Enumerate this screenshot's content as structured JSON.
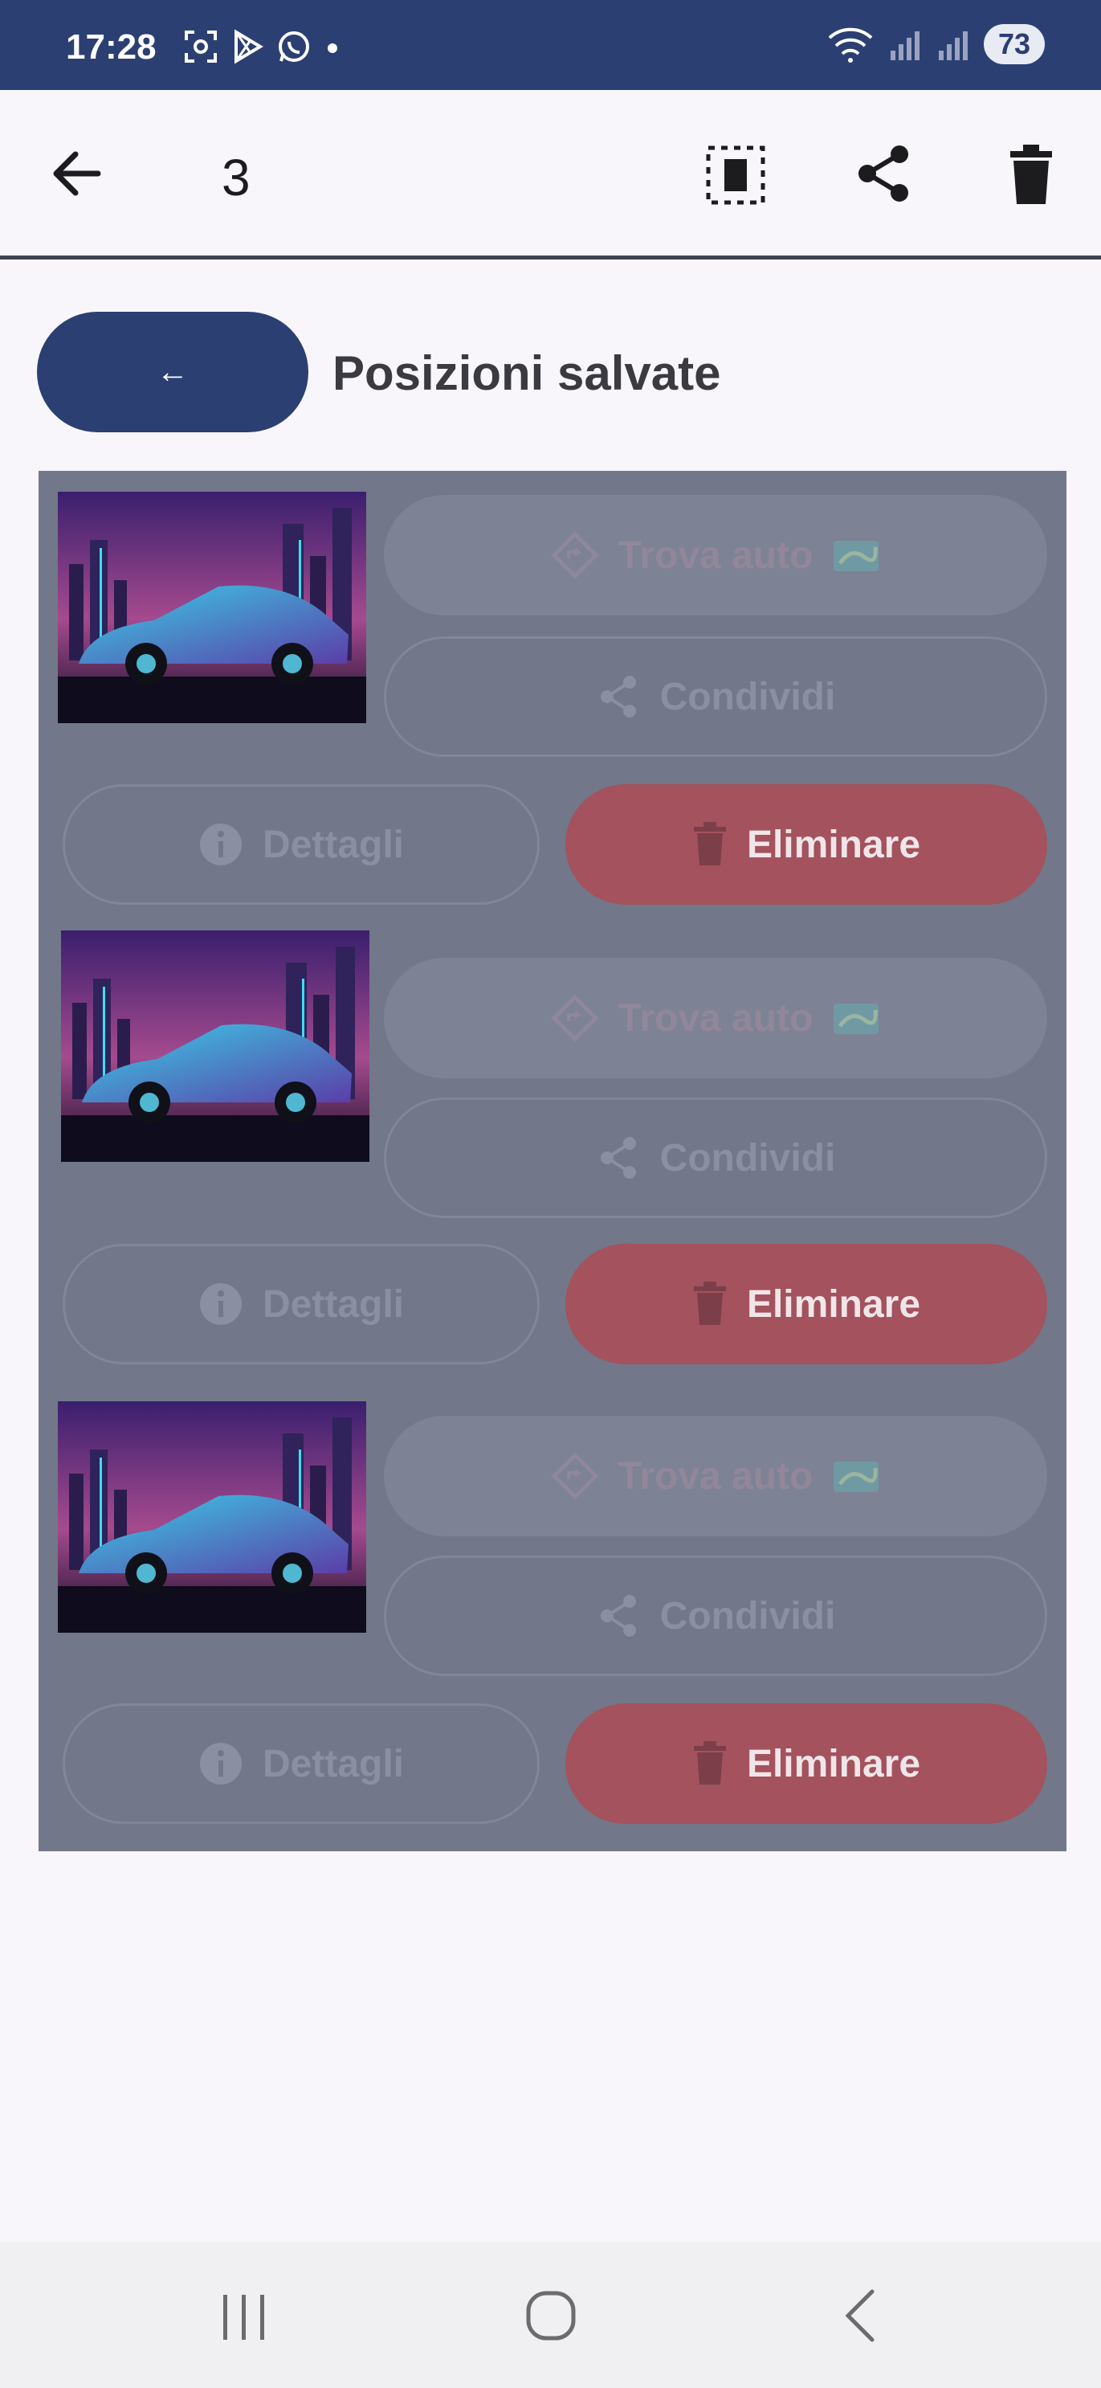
{
  "status_bar": {
    "time": "17:28",
    "battery": "73"
  },
  "topbar": {
    "selected_count": "3"
  },
  "header": {
    "back_label": "←",
    "title": "Posizioni salvate"
  },
  "cards": [
    {
      "find_label": "Trova auto",
      "share_label": "Condividi",
      "details_label": "Dettagli",
      "delete_label": "Eliminare"
    },
    {
      "find_label": "Trova auto",
      "share_label": "Condividi",
      "details_label": "Dettagli",
      "delete_label": "Eliminare"
    },
    {
      "find_label": "Trova auto",
      "share_label": "Condividi",
      "details_label": "Dettagli",
      "delete_label": "Eliminare"
    }
  ],
  "colors": {
    "brand": "#2b3f72",
    "overlay": "#727789",
    "delete": "#a4525d"
  }
}
